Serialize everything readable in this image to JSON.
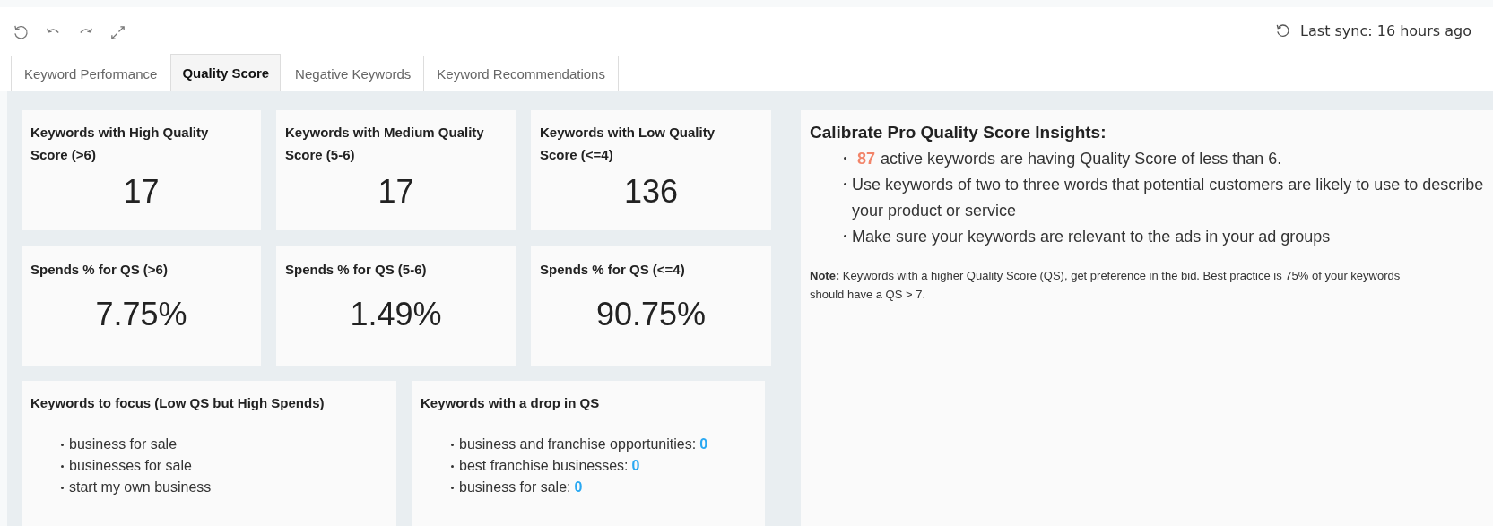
{
  "toolbar": {
    "sync": "Last sync: 16 hours ago"
  },
  "tabs": [
    {
      "label": "Keyword Performance",
      "selected": false
    },
    {
      "label": "Quality Score",
      "selected": true
    },
    {
      "label": "Negative Keywords",
      "selected": false
    },
    {
      "label": "Keyword Recommendations",
      "selected": false
    }
  ],
  "keyword_cards": [
    {
      "title": "Keywords with High Quality Score (>6)",
      "value": "17"
    },
    {
      "title": "Keywords with Medium Quality Score (5-6)",
      "value": "17"
    },
    {
      "title": "Keywords with Low Quality Score (<=4)",
      "value": "136"
    }
  ],
  "spend_cards": [
    {
      "title": "Spends % for QS (>6)",
      "value": "7.75%"
    },
    {
      "title": "Spends % for QS (5-6)",
      "value": "1.49%"
    },
    {
      "title": "Spends % for QS (<=4)",
      "value": "90.75%"
    }
  ],
  "focus": {
    "title": "Keywords to focus (Low QS but High Spends)",
    "items": [
      "business for sale",
      "businesses for sale",
      "start my own business"
    ]
  },
  "drop": {
    "title": "Keywords with a drop in QS",
    "items": [
      {
        "keyword": "business and franchise opportunities:",
        "count": "0"
      },
      {
        "keyword": "best franchise businesses:",
        "count": "0"
      },
      {
        "keyword": "business for sale:",
        "count": "0"
      }
    ]
  },
  "insights": {
    "title": "Calibrate Pro Quality Score Insights:",
    "items": [
      {
        "highlight": "87",
        "text": "active keywords are having Quality Score of less than 6."
      },
      {
        "text": "Use keywords of two to three words that potential customers are likely to use to describe your product or service"
      },
      {
        "text": "Make sure your keywords are relevant to the ads in your ad groups"
      }
    ],
    "note": "**Note:** Keywords with a higher Quality Score (QS), get preference in the bid. Best practice is 75% of your keywords should have a QS > 7."
  }
}
